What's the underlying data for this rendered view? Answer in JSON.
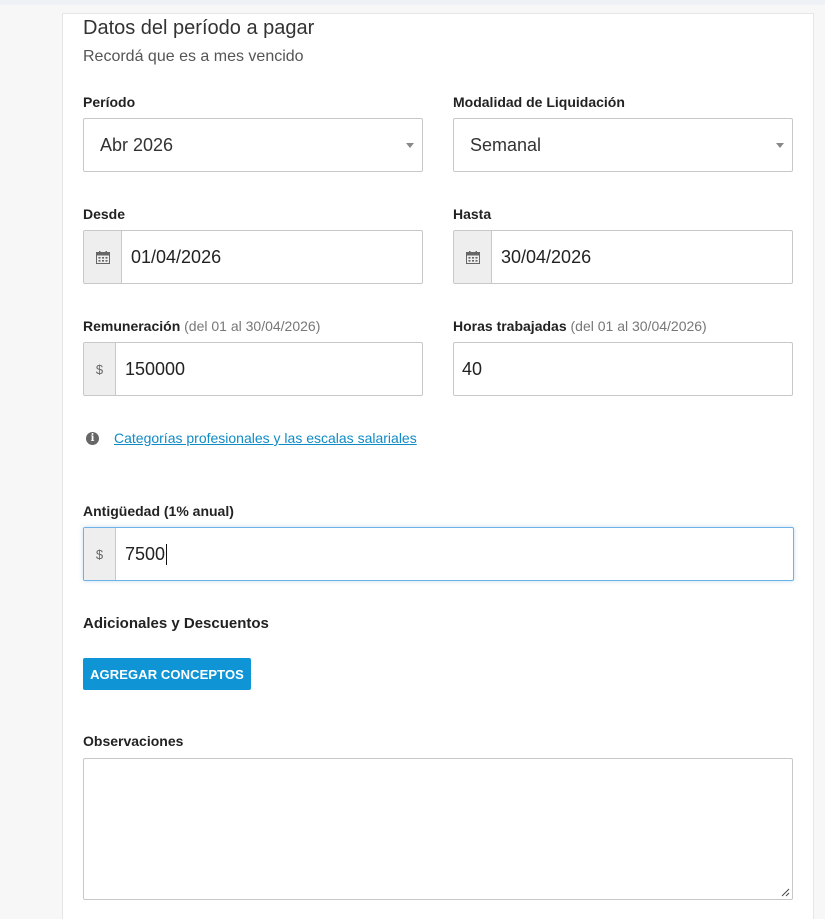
{
  "section": {
    "title": "Datos del período a pagar",
    "subtitle": "Recordá que es a mes vencido"
  },
  "periodo": {
    "label": "Período",
    "value": "Abr 2026"
  },
  "modalidad": {
    "label": "Modalidad de Liquidación",
    "value": "Semanal"
  },
  "desde": {
    "label": "Desde",
    "value": "01/04/2026",
    "icon": "calendar-icon"
  },
  "hasta": {
    "label": "Hasta",
    "value": "30/04/2026",
    "icon": "calendar-icon"
  },
  "remuneracion": {
    "label": "Remuneración",
    "hint": "(del 01 al 30/04/2026)",
    "currency": "$",
    "value": "150000"
  },
  "horas": {
    "label": "Horas trabajadas",
    "hint": "(del 01 al 30/04/2026)",
    "value": "40"
  },
  "info": {
    "icon": "info-icon",
    "link": "Categorías profesionales y las escalas salariales"
  },
  "antiguedad": {
    "label": "Antigüedad (1% anual)",
    "currency": "$",
    "value": "7500"
  },
  "adicionales": {
    "label": "Adicionales y Descuentos",
    "button": "AGREGAR CONCEPTOS"
  },
  "observaciones": {
    "label": "Observaciones",
    "value": ""
  },
  "colors": {
    "accent": "#0f95d6",
    "link": "#0f8bc6",
    "focus": "#6fb3e6"
  }
}
